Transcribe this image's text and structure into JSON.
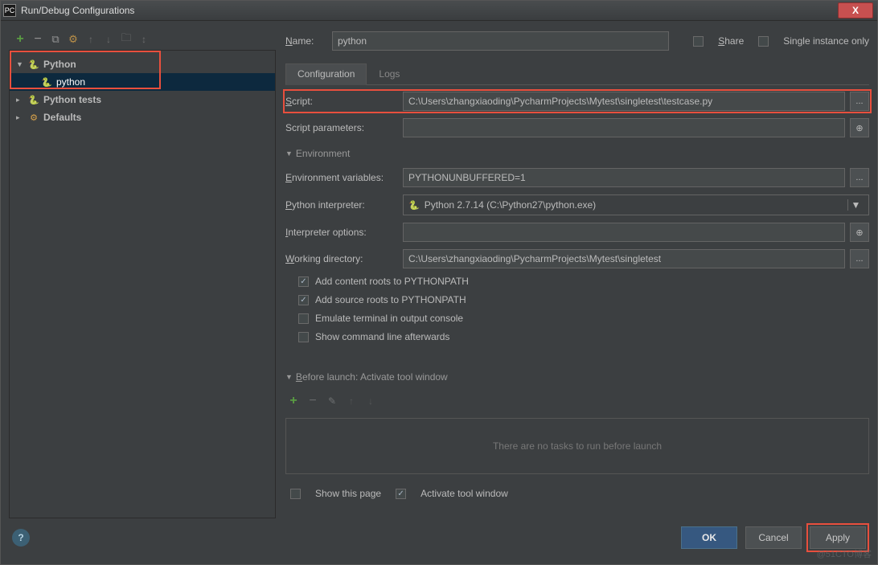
{
  "window": {
    "app_icon": "PC",
    "title": "Run/Debug Configurations",
    "close_glyph": "X"
  },
  "toolbar_icons": {
    "add": "+",
    "remove": "−",
    "copy": "⧉",
    "settings": "⚙",
    "up": "↑",
    "down": "↓",
    "folder": "🗀",
    "collapse": "↕"
  },
  "tree": {
    "items": [
      {
        "label": "Python",
        "level": 0,
        "expanded": true,
        "icon": "py",
        "bold": true
      },
      {
        "label": "python",
        "level": 1,
        "expanded": null,
        "icon": "py",
        "selected": true
      },
      {
        "label": "Python tests",
        "level": 0,
        "expanded": false,
        "icon": "py",
        "bold": true
      },
      {
        "label": "Defaults",
        "level": 0,
        "expanded": false,
        "icon": "gear",
        "bold": true
      }
    ]
  },
  "header": {
    "name_label": "Name:",
    "name_value": "python",
    "share_label": "Share",
    "single_instance_label": "Single instance only"
  },
  "tabs": {
    "configuration": "Configuration",
    "logs": "Logs"
  },
  "form": {
    "script_label": "Script:",
    "script_value": "C:\\Users\\zhangxiaoding\\PycharmProjects\\Mytest\\singletest\\testcase.py",
    "script_params_label": "Script parameters:",
    "script_params_value": "",
    "environment_header": "Environment",
    "env_vars_label": "Environment variables:",
    "env_vars_value": "PYTHONUNBUFFERED=1",
    "interpreter_label": "Python interpreter:",
    "interpreter_value": "Python 2.7.14 (C:\\Python27\\python.exe)",
    "interpreter_options_label": "Interpreter options:",
    "interpreter_options_value": "",
    "working_dir_label": "Working directory:",
    "working_dir_value": "C:\\Users\\zhangxiaoding\\PycharmProjects\\Mytest\\singletest",
    "add_content_roots": "Add content roots to PYTHONPATH",
    "add_source_roots": "Add source roots to PYTHONPATH",
    "emulate_terminal": "Emulate terminal in output console",
    "show_cmdline": "Show command line afterwards"
  },
  "before_launch": {
    "header": "Before launch: Activate tool window",
    "empty_text": "There are no tasks to run before launch",
    "toolbar": {
      "add": "+",
      "remove": "−",
      "edit": "✎",
      "up": "↑",
      "down": "↓"
    }
  },
  "bottom": {
    "show_this_page": "Show this page",
    "activate_tool_window": "Activate tool window"
  },
  "footer": {
    "help": "?",
    "ok": "OK",
    "cancel": "Cancel",
    "apply": "Apply"
  },
  "misc": {
    "ellipsis": "...",
    "expand_plus": "⊕",
    "dd_arrow": "▼",
    "tri_down": "▼",
    "tri_right": "▸"
  },
  "watermark": "@51CTO博客"
}
